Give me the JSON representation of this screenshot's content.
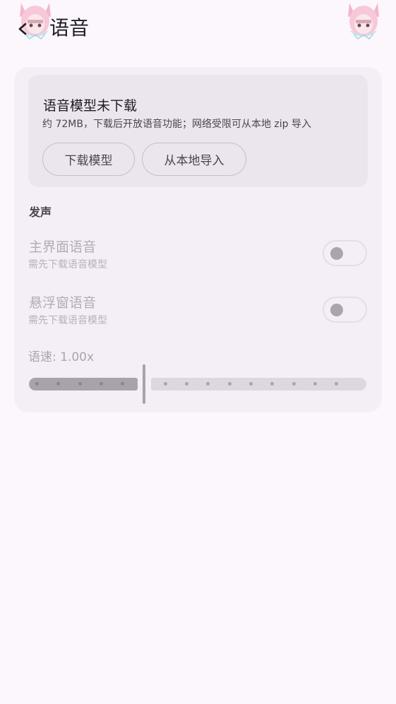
{
  "header": {
    "title": "语音",
    "back_icon": "arrow-back-icon",
    "mascot_icon": "anime-girl-mascot-icon"
  },
  "download": {
    "title": "语音模型未下载",
    "description": "约 72MB，下载后开放语音功能；网络受限可从本地 zip 导入",
    "download_button": "下载模型",
    "import_button": "从本地导入"
  },
  "section": {
    "label": "发声"
  },
  "settings": [
    {
      "title": "主界面语音",
      "subtitle": "需先下载语音模型",
      "enabled": false
    },
    {
      "title": "悬浮窗语音",
      "subtitle": "需先下载语音模型",
      "enabled": false
    }
  ],
  "speed": {
    "label": "语速: 1.00x",
    "value": 1.0,
    "min": 0.5,
    "max": 2.0,
    "step": 0.1
  },
  "colors": {
    "background": "#fcf7fc",
    "card": "#f4eff6",
    "panel": "#ebe5ee",
    "disabled_text": "#b1adb4",
    "slider_active": "#a8a3ab",
    "slider_inactive": "#ddd8df"
  }
}
